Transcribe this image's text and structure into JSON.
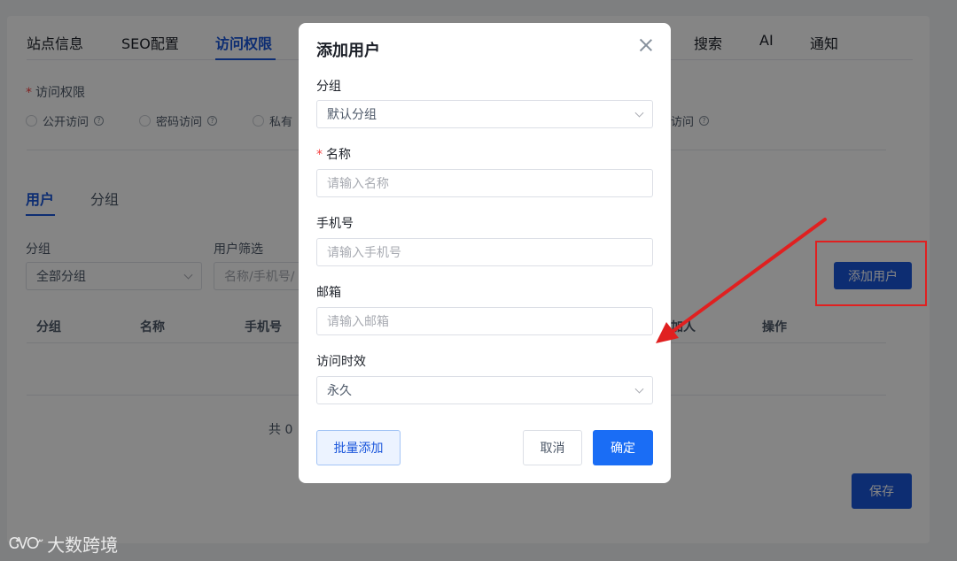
{
  "tabs": [
    "站点信息",
    "SEO配置",
    "访问权限",
    "搜索",
    "AI",
    "通知"
  ],
  "access": {
    "label": "访问权限",
    "options": [
      "公开访问",
      "密码访问",
      "私有",
      "访问"
    ],
    "help_glyph": "?"
  },
  "subtabs": [
    "用户",
    "分组"
  ],
  "filters": {
    "group_label": "分组",
    "group_value": "全部分组",
    "user_filter_label": "用户筛选",
    "user_filter_placeholder": "名称/手机号/"
  },
  "add_user_button": "添加用户",
  "table": {
    "headers": [
      "分组",
      "名称",
      "手机号",
      "加人",
      "操作"
    ]
  },
  "total_text": "共 0",
  "save_button": "保存",
  "modal": {
    "title": "添加用户",
    "fields": {
      "group_label": "分组",
      "group_value": "默认分组",
      "name_label": "名称",
      "name_placeholder": "请输入名称",
      "phone_label": "手机号",
      "phone_placeholder": "请输入手机号",
      "email_label": "邮箱",
      "email_placeholder": "请输入邮箱",
      "validity_label": "访问时效",
      "validity_value": "永久"
    },
    "bulk_add_button": "批量添加",
    "cancel_button": "取消",
    "confirm_button": "确定"
  },
  "watermark": {
    "logo": "ᏣᏙᏅ",
    "text": "大数跨境"
  },
  "colors": {
    "accent": "#1a56db",
    "confirm": "#1a6df5",
    "annotation": "#e02020"
  }
}
